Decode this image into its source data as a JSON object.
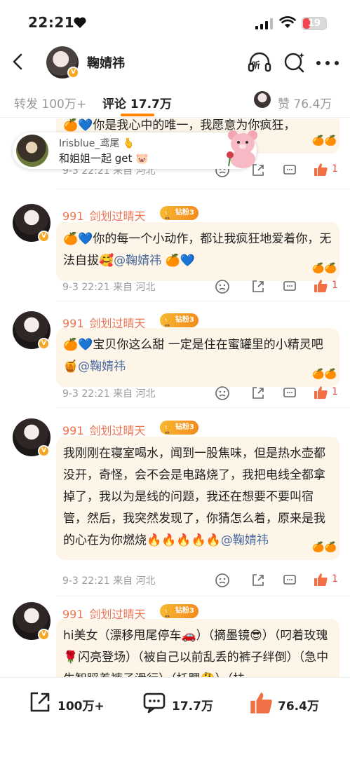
{
  "status": {
    "time": "22:21",
    "battery": "19"
  },
  "nav": {
    "title": "鞠婧祎",
    "listen_label": "听"
  },
  "tabs": {
    "repost": "转发 100万+",
    "comments": "评论 17.7万",
    "likes": "赞 76.4万"
  },
  "popup": {
    "user": "Irisblue_鸢尾 🫰",
    "text": "和姐姐一起 get 🐷"
  },
  "top_partial": {
    "text": "🍊💙你是我心中的唯一，我愿意为你疯狂，",
    "meta": "9-3 22:21 来自 河北",
    "likes": "1"
  },
  "comments": [
    {
      "user": "991_剑划过晴天",
      "badge": "钻粉3",
      "text": "🍊💙你的每一个小动作，都让我疯狂地爱着你，无法自拔🥰",
      "mention": "@鞠婧祎",
      "tail": " 🍊💙",
      "meta": "9-3 22:21 来自 河北",
      "likes": "1"
    },
    {
      "user": "991_剑划过晴天",
      "badge": "钻粉3",
      "text": "🍊💙宝贝你这么甜 一定是住在蜜罐里的小精灵吧🍯",
      "mention": "@鞠婧祎",
      "tail": "",
      "meta": "9-3 22:21 来自 河北",
      "likes": "1"
    },
    {
      "user": "991_剑划过晴天",
      "badge": "钻粉3",
      "text": "我刚刚在寝室喝水，闻到一股焦味，但是热水壶都没开，奇怪，会不会是电路烧了，我把电线全都拿掉了，我以为是线的问题，我还在想要不要叫宿管，然后，我突然发现了，你猜怎么着，原来是我的心在为你燃烧🔥🔥🔥🔥🔥",
      "mention": "@鞠婧祎",
      "tail": "",
      "meta": "9-3 22:21 来自 河北",
      "likes": "1"
    },
    {
      "user": "991_剑划过晴天",
      "badge": "钻粉3",
      "text": "hi美女（漂移甩尾停车🚗）（摘墨镜😎）（叼着玫瑰🌹闪亮登场）（被自己以前乱丢的裤子绊倒）（急中生智踩着裤子滑行）（托腮🤔）（扶",
      "mention": "",
      "tail": "",
      "meta": "",
      "likes": ""
    }
  ],
  "bottombar": {
    "repost": "100万+",
    "comment": "17.7万",
    "like": "76.4万"
  },
  "colors": {
    "accent": "#ff8200",
    "username": "#eb7350",
    "mention": "#4a6a9f",
    "like_red": "#eb4b4b",
    "bubble": "#fdf5e8"
  }
}
